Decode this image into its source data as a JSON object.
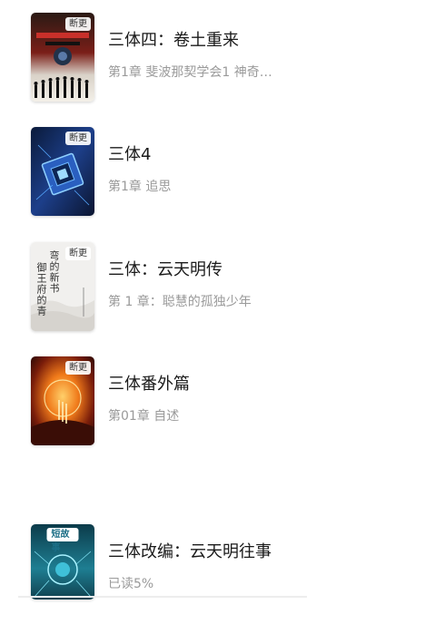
{
  "books": [
    {
      "title": "三体四：卷土重来",
      "subtitle": "第1章 斐波那契学会1 神奇…",
      "badge": "断更"
    },
    {
      "title": "三体4",
      "subtitle": "第1章 追思",
      "badge": "断更"
    },
    {
      "title": "三体：云天明传",
      "subtitle": "第 1 章：聪慧的孤独少年",
      "badge": "断更",
      "cover_text_right": "弯的新书",
      "cover_text_left": "御王府的青"
    },
    {
      "title": "三体番外篇",
      "subtitle": "第01章 自述",
      "badge": "断更"
    },
    {
      "title": "三体改编：云天明往事",
      "subtitle": "已读5%",
      "badge": "短故事"
    }
  ],
  "colors": {
    "title": "#1a1a1a",
    "subtitle": "#9a9a9a",
    "background": "#ffffff"
  }
}
